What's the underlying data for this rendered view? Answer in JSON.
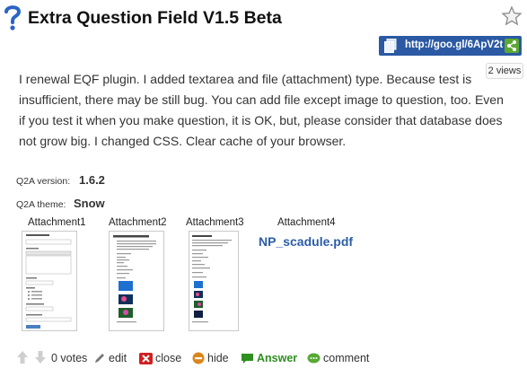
{
  "question": {
    "title": "Extra Question Field V1.5 Beta",
    "shortlink": "http://goo.gl/6ApV2t",
    "views": "2 views",
    "body_lines": [
      "I renewal EQF plugin. I added textarea and file (attachment) type. Because test is",
      "insufficient, there may be still bug. You can add file except image to question, too. Even",
      "if you test it when you make question, it is OK, but, please consider that database does",
      "not grow big. I changed CSS. Clear cache of your browser."
    ]
  },
  "meta": {
    "version_label": "Q2A version:",
    "version_value": "1.6.2",
    "theme_label": "Q2A theme:",
    "theme_value": "Snow"
  },
  "attachments": [
    {
      "label": "Attachment1"
    },
    {
      "label": "Attachment2"
    },
    {
      "label": "Attachment3"
    },
    {
      "label": "Attachment4",
      "link": "NP_scadule.pdf"
    }
  ],
  "actions": {
    "votes": "0 votes",
    "edit": "edit",
    "close": "close",
    "hide": "hide",
    "answer": "Answer",
    "comment": "comment"
  },
  "colors": {
    "shortlink_bg": "#2b59a3",
    "link": "#2c5da6",
    "answer_green": "#2f8f1f",
    "close_red": "#d02020",
    "hide_orange": "#d9861c"
  },
  "icons": [
    "question-mark-icon",
    "star-icon",
    "document-icon",
    "share-icon",
    "vote-up-icon",
    "vote-down-icon",
    "pencil-icon",
    "close-x-icon",
    "hide-icon",
    "answer-icon",
    "comment-icon"
  ]
}
